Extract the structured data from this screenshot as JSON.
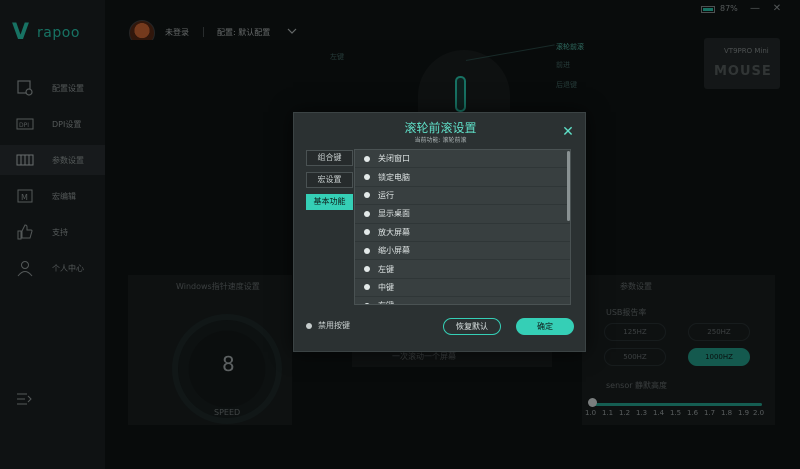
{
  "app": {
    "brand": "rapoo",
    "user_name": "未登录",
    "config_label": "配置: 默认配置",
    "battery": "87%"
  },
  "sidebar": {
    "items": [
      {
        "label": "配置设置",
        "icon": "config-icon"
      },
      {
        "label": "DPI设置",
        "icon": "dpi-icon"
      },
      {
        "label": "参数设置",
        "icon": "params-icon"
      },
      {
        "label": "宏编辑",
        "icon": "macro-icon"
      },
      {
        "label": "支持",
        "icon": "thumbs-up-icon"
      },
      {
        "label": "个人中心",
        "icon": "user-icon"
      }
    ],
    "active_index": 2
  },
  "device": {
    "model": "VT9PRO Mini",
    "mouse_word": "MOUSE",
    "callouts": [
      "滚轮前滚",
      "前进",
      "后退键",
      "左键"
    ]
  },
  "background_panels": {
    "pointer_title": "Windows指针速度设置",
    "gauge_value": "8",
    "gauge_label": "SPEED",
    "scroll_hint": "一次滚动一个屏幕",
    "params_title": "参数设置",
    "usb_rate_label": "USB报告率",
    "rates": [
      "125HZ",
      "250HZ",
      "500HZ",
      "1000HZ"
    ],
    "active_rate": "1000HZ",
    "lod_label": "sensor 静默高度",
    "lod_ticks": [
      "1.0",
      "1.1",
      "1.2",
      "1.3",
      "1.4",
      "1.5",
      "1.6",
      "1.7",
      "1.8",
      "1.9",
      "2.0"
    ]
  },
  "modal": {
    "title": "滚轮前滚设置",
    "subtitle": "当前功能: 滚轮前滚",
    "tabs": [
      {
        "label": "组合键",
        "active": false
      },
      {
        "label": "宏设置",
        "active": false
      },
      {
        "label": "基本功能",
        "active": true
      }
    ],
    "functions": [
      "关闭窗口",
      "锁定电脑",
      "运行",
      "显示桌面",
      "放大屏幕",
      "缩小屏幕",
      "左键",
      "中键",
      "右键"
    ],
    "disable_label": "禁用按键",
    "restore_label": "恢复默认",
    "ok_label": "确定",
    "close_glyph": "✕"
  }
}
